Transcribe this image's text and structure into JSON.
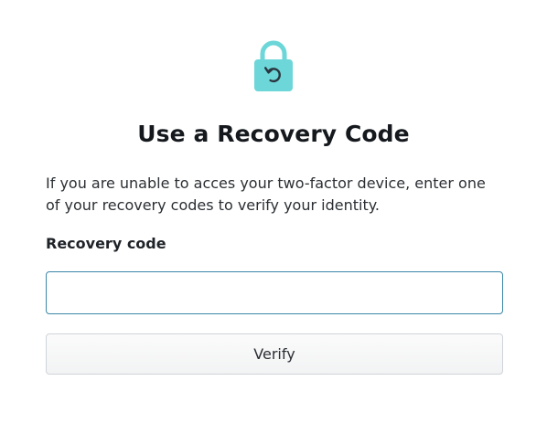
{
  "colors": {
    "lock_body": "#6cd6d8",
    "lock_shackle": "#6cd6d8",
    "lock_symbol": "#2b3540",
    "input_border": "#3b87a7",
    "button_border": "#cfd4d9"
  },
  "icon": {
    "name": "padlock-recovery-icon"
  },
  "heading": {
    "title": "Use a Recovery Code"
  },
  "description": {
    "text": "If you are unable to acces your two-factor device, enter one of your recovery codes to verify your identity."
  },
  "form": {
    "recovery_label": "Recovery code",
    "recovery_value": "",
    "recovery_placeholder": "",
    "submit_label": "Verify"
  }
}
